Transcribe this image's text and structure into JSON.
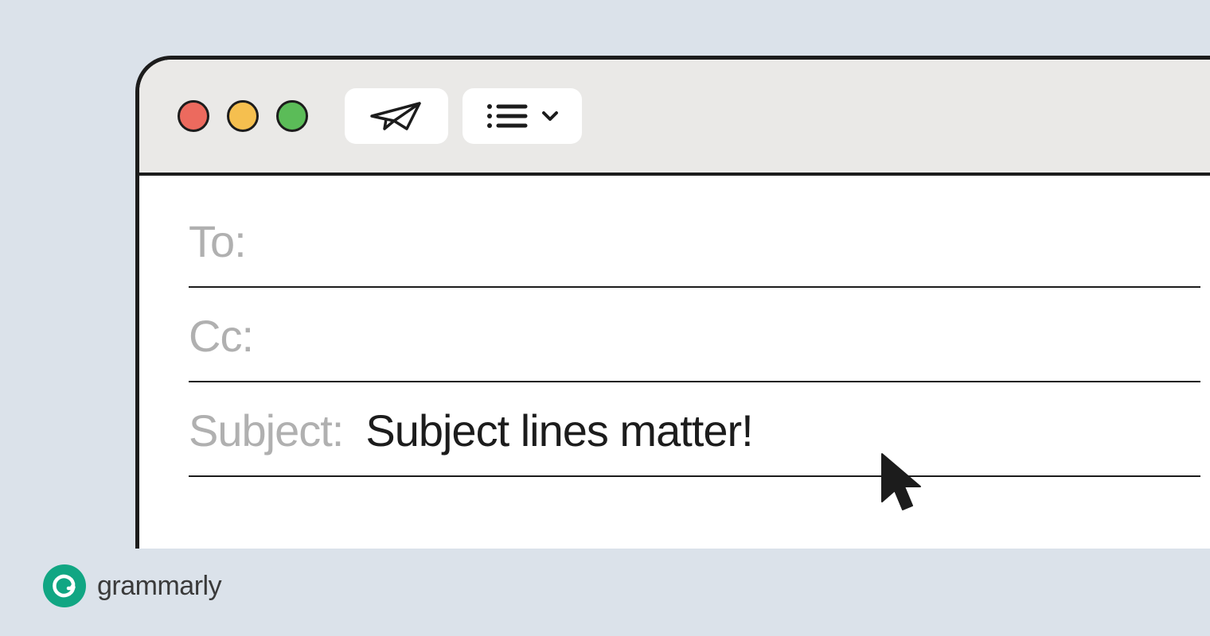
{
  "fields": {
    "to_label": "To:",
    "to_value": "",
    "cc_label": "Cc:",
    "cc_value": "",
    "subject_label": "Subject:",
    "subject_value": "Subject lines matter!"
  },
  "toolbar": {
    "close_icon": "close",
    "minimize_icon": "minimize",
    "maximize_icon": "maximize",
    "send_icon": "paper-plane",
    "format_icon": "list",
    "dropdown_icon": "chevron-down"
  },
  "brand": {
    "name": "grammarly"
  },
  "colors": {
    "background": "#dbe2ea",
    "window_border": "#1c1c1c",
    "toolbar_bg": "#eae9e7",
    "label_grey": "#b0b0b0",
    "brand_green": "#11a683",
    "dot_red": "#ec6a5e",
    "dot_yellow": "#f5bf4f",
    "dot_green": "#5bbc58"
  }
}
